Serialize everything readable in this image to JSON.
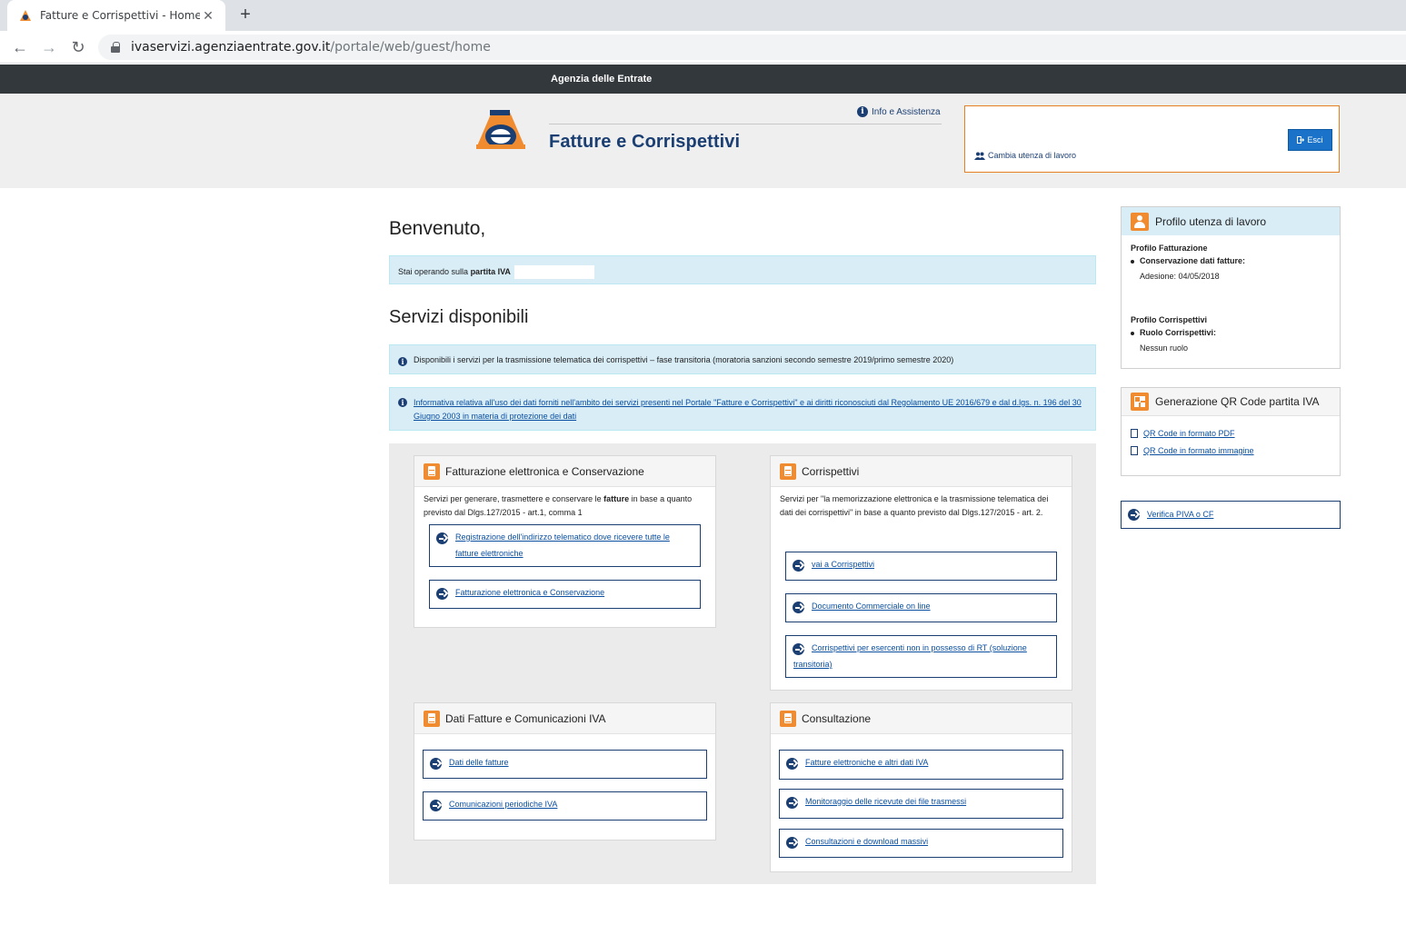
{
  "browser": {
    "tab_title": "Fatture e Corrispettivi - Home",
    "close_glyph": "✕",
    "newtab_glyph": "+",
    "back_glyph": "←",
    "forward_glyph": "→",
    "reload_glyph": "↻",
    "url_host": "ivaservizi.agenziaentrate.gov.it",
    "url_path": "/portale/web/guest/home"
  },
  "topbar": {
    "title": "Agenzia delle Entrate"
  },
  "header": {
    "site_title": "Fatture e Corrispettivi",
    "info_link": "Info e Assistenza",
    "esci_label": "Esci",
    "cambia_link": "Cambia utenza di lavoro"
  },
  "main": {
    "welcome": "Benvenuto,",
    "piva_prefix": "Stai operando sulla ",
    "piva_label": "partita IVA",
    "section_title": "Servizi disponibili",
    "notice": "Disponibili i servizi per la trasmissione telematica dei corrispettivi – fase transitoria (moratoria sanzioni secondo semestre 2019/primo semestre 2020)",
    "privacy_link": "Informativa relativa all'uso dei dati forniti nell'ambito dei servizi presenti nel Portale \"Fatture e Corrispettivi\" e ai diritti riconosciuti dal Regolamento UE 2016/679 e dal d.lgs. n. 196 del 30 Giugno 2003 in materia di protezione dei dati"
  },
  "panels": {
    "fatturazione": {
      "title": "Fatturazione elettronica e Conservazione",
      "desc_pre": "Servizi per generare, trasmettere e conservare le ",
      "desc_bold": "fatture",
      "desc_post": " in base a quanto previsto dal Dlgs.127/2015 - art.1, comma 1",
      "links": [
        "Registrazione dell'indirizzo telematico dove ricevere tutte le fatture elettroniche",
        "Fatturazione elettronica e Conservazione"
      ]
    },
    "corrispettivi": {
      "title": "Corrispettivi",
      "desc": "Servizi per \"la memorizzazione elettronica e la trasmissione telematica dei dati dei corrispettivi\" in base a quanto previsto dal Dlgs.127/2015 - art. 2.",
      "links": [
        "vai a Corrispettivi",
        "Documento Commerciale on line",
        "Corrispettivi per esercenti non in possesso di RT (soluzione transitoria)"
      ]
    },
    "dati": {
      "title": "Dati Fatture e Comunicazioni IVA",
      "links": [
        "Dati delle fatture",
        "Comunicazioni periodiche IVA"
      ]
    },
    "consultazione": {
      "title": "Consultazione",
      "links": [
        "Fatture elettroniche e altri dati IVA",
        "Monitoraggio delle ricevute dei file trasmessi",
        "Consultazioni e download massivi"
      ]
    }
  },
  "sidebar": {
    "profilo": {
      "title": "Profilo utenza di lavoro",
      "fatt_title": "Profilo Fatturazione",
      "fatt_item": "Conservazione dati fatture:",
      "fatt_value": "Adesione: 04/05/2018",
      "corr_title": "Profilo Corrispettivi",
      "corr_item": "Ruolo Corrispettivi:",
      "corr_value": "Nessun ruolo"
    },
    "qr": {
      "title": "Generazione QR Code partita IVA",
      "links": [
        "QR Code in formato PDF",
        "QR Code in formato immagine"
      ]
    },
    "verifica": "Verifica PIVA o CF"
  },
  "colors": {
    "accent_orange": "#f08c2f",
    "brand_navy": "#1b3f73",
    "button_blue": "#1a73c9",
    "alert_blue": "#d9edf7"
  }
}
